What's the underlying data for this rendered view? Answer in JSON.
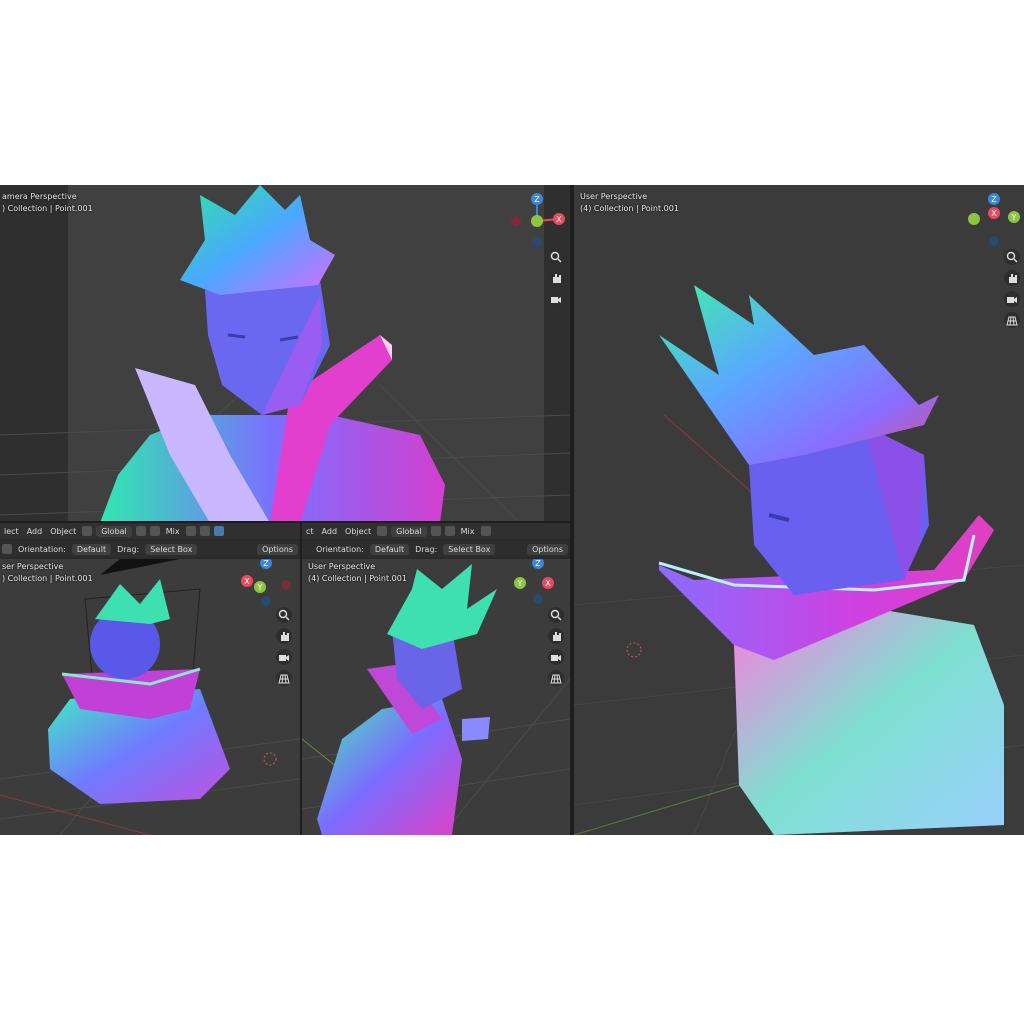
{
  "viewports": {
    "camera": {
      "name": "amera Perspective",
      "collection": ") Collection | Point.001"
    },
    "bottom_left": {
      "name": "ser Perspective",
      "collection": ") Collection | Point.001"
    },
    "bottom_mid": {
      "name": "User Perspective",
      "collection": "(4) Collection | Point.001"
    },
    "right": {
      "name": "User Perspective",
      "collection": "(4) Collection | Point.001"
    }
  },
  "header_left": {
    "menu": [
      "lect",
      "Add",
      "Object"
    ],
    "transform": "Global",
    "snap": "Mix",
    "orientation_label": "Orientation:",
    "orientation_value": "Default",
    "drag_label": "Drag:",
    "drag_value": "Select Box",
    "options": "Options"
  },
  "header_mid": {
    "menu": [
      "ct",
      "Add",
      "Object"
    ],
    "transform": "Global",
    "snap": "Mix",
    "orientation_label": "Orientation:",
    "orientation_value": "Default",
    "drag_label": "Drag:",
    "drag_value": "Select Box",
    "options": "Options"
  },
  "gizmo": {
    "x": "X",
    "y": "Y",
    "z": "Z"
  },
  "colors": {
    "x_axis": "#e84a5f",
    "y_axis": "#8cc63f",
    "z_axis": "#3a86d8",
    "grid": "#4a4a4a"
  },
  "icons": [
    "zoom-icon",
    "hand-icon",
    "camera-icon",
    "grid-icon"
  ]
}
